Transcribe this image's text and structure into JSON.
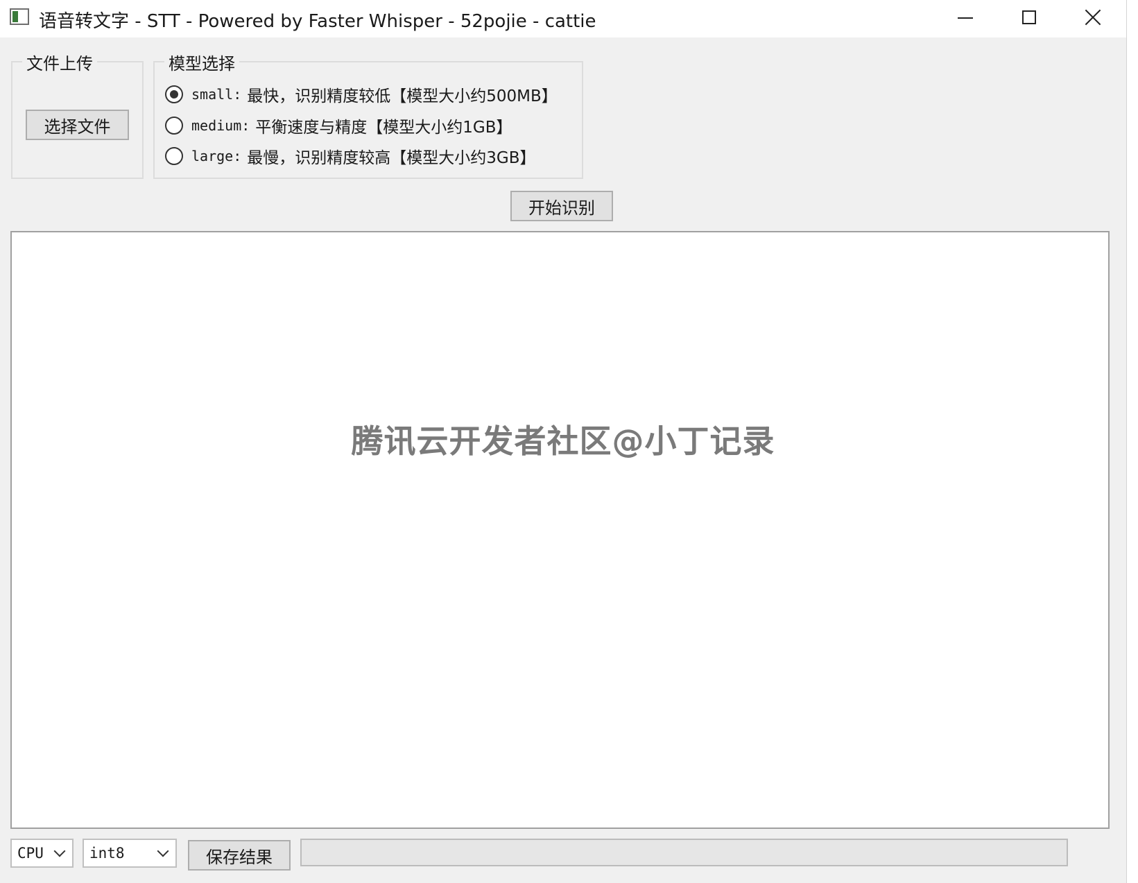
{
  "window": {
    "title": "语音转文字 - STT - Powered by Faster Whisper - 52pojie - cattie"
  },
  "upload": {
    "group_title": "文件上传",
    "choose_button": "选择文件"
  },
  "model": {
    "group_title": "模型选择",
    "selected": "small",
    "options": [
      {
        "code": "small:",
        "desc": "最快，识别精度较低【模型大小约500MB】",
        "checked": true
      },
      {
        "code": "medium:",
        "desc": "平衡速度与精度【模型大小约1GB】",
        "checked": false
      },
      {
        "code": "large:",
        "desc": "最慢，识别精度较高【模型大小约3GB】",
        "checked": false
      }
    ]
  },
  "actions": {
    "start_button": "开始识别",
    "save_button": "保存结果"
  },
  "output": {
    "text": "",
    "watermark": "腾讯云开发者社区@小丁记录"
  },
  "settings": {
    "device": "CPU",
    "compute_type": "int8"
  },
  "progress": {
    "value": 0
  },
  "colors": {
    "window_bg": "#f0f0f0",
    "progress_fill": "#06b025"
  }
}
